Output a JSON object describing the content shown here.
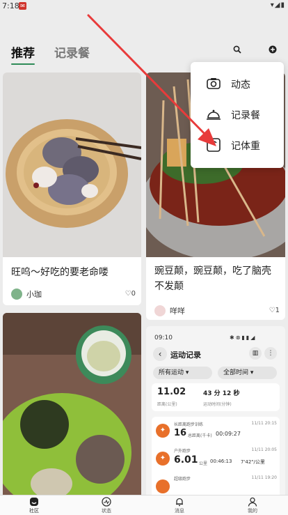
{
  "status_bar": {
    "time": "7:18",
    "notification_badge": "✉",
    "system_icons": "▾◢▮"
  },
  "header": {
    "tabs": [
      {
        "label": "推荐",
        "active": true
      },
      {
        "label": "记录餐",
        "active": false
      }
    ],
    "search_icon": "search-icon",
    "add_icon": "plus-circle-icon"
  },
  "feed": {
    "cards": [
      {
        "title": "旺呜～好吃的要老命喽",
        "author": "小珈",
        "likes": "0"
      },
      {
        "title": "豌豆颠，豌豆颠，吃了脑壳不发颠",
        "author": "咩咩",
        "likes": "1"
      }
    ],
    "screenshot_card": {
      "phone_time": "09:10",
      "page_title": "运动记录",
      "filter_left": "所有运动",
      "filter_right": "全部时间",
      "summary_value": "11.02",
      "summary_unit_label": "距离(公里)",
      "summary_duration": "43 分 12 秒",
      "summary_duration_label": "运动时间(分钟)",
      "records": [
        {
          "name": "长距离跑步训练",
          "date": "11/11 20:15",
          "value": "16",
          "unit": "总距离(千卡)",
          "time": "00:09:27",
          "pace": ""
        },
        {
          "name": "户外跑步",
          "date": "11/11 20:05",
          "value": "6.01",
          "unit": "公里",
          "time": "00:46:13",
          "pace": "7'42\"/公里"
        },
        {
          "name": "超级跑步",
          "date": "11/11 19:20",
          "value": "",
          "unit": "",
          "time": "",
          "pace": ""
        }
      ]
    }
  },
  "popup_menu": {
    "items": [
      {
        "label": "动态",
        "icon": "camera-icon"
      },
      {
        "label": "记录餐",
        "icon": "food-cloche-icon"
      },
      {
        "label": "记体重",
        "icon": "scale-icon"
      }
    ]
  },
  "bottom_nav": {
    "items": [
      {
        "label": "社区",
        "icon": "community-icon",
        "active": true
      },
      {
        "label": "状态",
        "icon": "status-icon",
        "active": false
      },
      {
        "label": "消息",
        "icon": "bell-icon",
        "active": false
      },
      {
        "label": "我的",
        "icon": "person-icon",
        "active": false
      }
    ]
  },
  "colors": {
    "accent": "#2e8b57",
    "arrow": "#e83b3b",
    "tracker_orange": "#e8702a"
  }
}
